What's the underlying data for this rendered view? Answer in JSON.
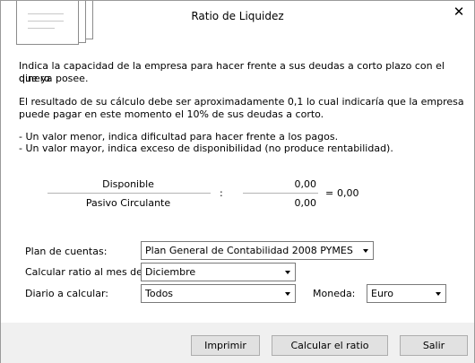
{
  "dialog": {
    "title": "Ratio de Liquidez",
    "close_glyph": "✕"
  },
  "description": {
    "line1": "Indica la  capacidad de la empresa para hacer frente a sus deudas a corto plazo con el dinero",
    "line2": "que ya posee.",
    "line3": "El resultado de su cálculo debe ser aproximadamente 0,1 lo cual  indicaría que la empresa",
    "line4": "puede pagar en este momento el 10% de sus deudas a corto.",
    "line5": "- Un valor menor, indica dificultad para hacer frente a los pagos.",
    "line6": "- Un valor mayor, indica exceso de disponibilidad (no produce rentabilidad)."
  },
  "ratio": {
    "numerator_label": "Disponible",
    "denominator_label": "Pasivo Circulante",
    "operator": ":",
    "numerator_value": "0,00",
    "denominator_value": "0,00",
    "equals": "=",
    "result": "0,00"
  },
  "form": {
    "plan_label": "Plan de cuentas:",
    "plan_value": "Plan General de Contabilidad 2008 PYMES",
    "month_label": "Calcular ratio al mes de:",
    "month_value": "Diciembre",
    "diary_label": "Diario a calcular:",
    "diary_value": "Todos",
    "currency_label": "Moneda:",
    "currency_value": "Euro"
  },
  "buttons": {
    "print": "Imprimir",
    "calculate": "Calcular el ratio",
    "exit": "Salir"
  },
  "icons": {
    "header": "stacked-documents-icon",
    "close": "close-icon",
    "dropdown": "chevron-down-icon"
  },
  "colors": {
    "footer_bg": "#f0f0f0",
    "button_bg": "#e1e1e1",
    "button_border": "#adadad",
    "divider": "#b4b4b4"
  }
}
